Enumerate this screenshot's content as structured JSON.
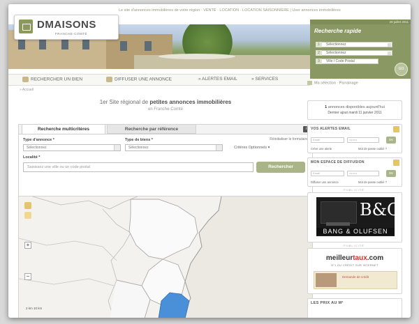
{
  "top_links": "Le site d'annonces immobilières de votre région · VENTE · LOCATION · LOCATION SAISONNIÈRE  |  User annonces immobilières",
  "logo": {
    "name": "DMAISONS",
    "sub": "FRANCHE-COMTÉ"
  },
  "date": "28 juillet 2011",
  "quick_search": {
    "title": "Recherche rapide",
    "rows": [
      {
        "num": "1",
        "value": "Sélectionnez"
      },
      {
        "num": "2",
        "value": "Sélectionnez"
      },
      {
        "num": "3",
        "value": "Ville / Code Postal"
      }
    ],
    "go": "GO"
  },
  "nav": {
    "items": [
      {
        "label": "RECHERCHER UN BIEN"
      },
      {
        "label": "DIFFUSER UNE ANNONCE"
      },
      {
        "label": "» ALERTES EMAIL"
      },
      {
        "label": "» SERVICES"
      }
    ]
  },
  "selection": "Ma sélection  ·  Parrainage",
  "breadcrumb": "» Accueil",
  "tagline": {
    "prefix": "1er Site régional de ",
    "bold": "petites annonces immobilières",
    "line2": "en Franche-Comté"
  },
  "search": {
    "tabs": [
      "Recherche multicritères",
      "Recherche par référence"
    ],
    "info": "i",
    "reset": "Réinitialiser le formulaire",
    "type_annonce_label": "Type d'annonce *",
    "type_annonce_value": "Sélectionnez",
    "type_bien_label": "Type de biens *",
    "type_bien_value": "Sélectionnez",
    "criteres": "Critères Optionnels ▾",
    "localite_label": "Localité *",
    "localite_placeholder": "Saisissez une ville ou un code postal",
    "button": "Rechercher"
  },
  "map": {
    "zoom_in": "+",
    "zoom_out": "−",
    "scale": "2 km      10 km"
  },
  "sidebar": {
    "count": {
      "num": "1",
      "text": " annonces disponibles aujourd'hui",
      "line2": "Dernier ajout mardi 11 janvier 2011"
    },
    "alertes": {
      "title": "VOS ALERTES EMAIL",
      "email_ph": "Email",
      "pass_ph": "••••••••",
      "ok": "OK",
      "link1": "Créer une alerte",
      "link2": "Mot de passe oublié ?"
    },
    "diffusion": {
      "title": "MON ESPACE DE DIFFUSION",
      "email_ph": "Email",
      "pass_ph": "••••••••",
      "ok": "OK",
      "link1": "Diffuser une annonce",
      "link2": "Mot de passe oublié ?"
    },
    "pub_label": "PUBLICITÉ",
    "bo": {
      "letters": "B&O",
      "name": "BANG & OLUFSEN"
    },
    "meilleurtaux": {
      "name_a": "meilleur",
      "name_b": "taux",
      "name_c": ".com",
      "sub": "N°1 DU CRÉDIT SUR INTERNET",
      "ad": "Demande de crédit"
    },
    "prix": {
      "title": "LES PRIX AU M²"
    }
  }
}
